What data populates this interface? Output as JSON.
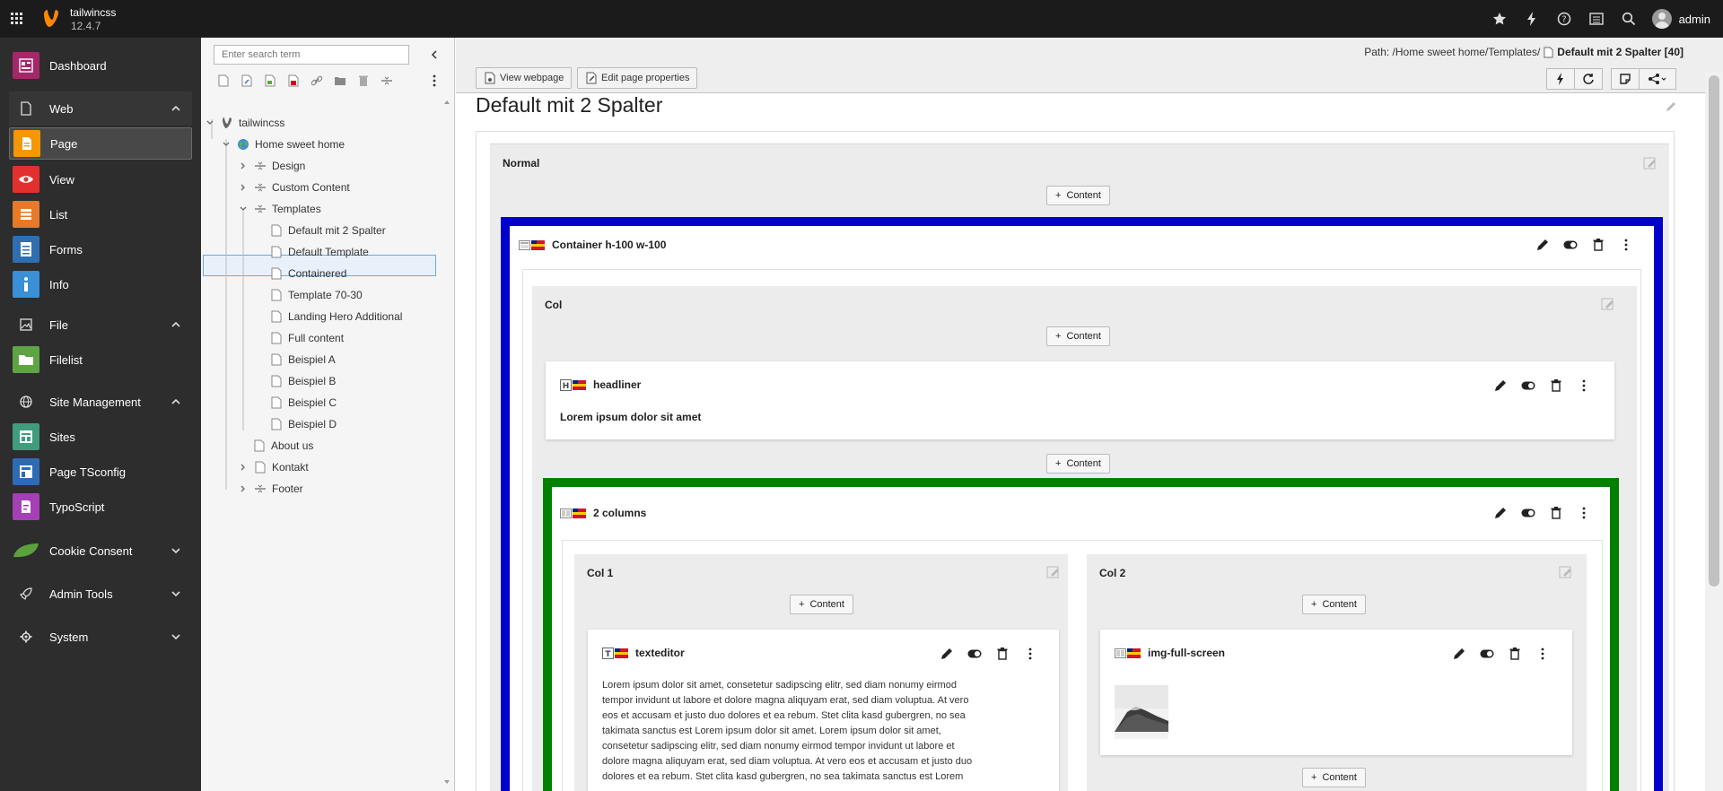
{
  "topbar": {
    "site_name": "tailwincss",
    "version": "12.4.7",
    "user": "admin"
  },
  "modules": {
    "dashboard": "Dashboard",
    "web": "Web",
    "page": "Page",
    "view": "View",
    "list": "List",
    "forms": "Forms",
    "info": "Info",
    "file": "File",
    "filelist": "Filelist",
    "site_management": "Site Management",
    "sites": "Sites",
    "page_tsconfig": "Page TSconfig",
    "typoscript": "TypoScript",
    "cookie_consent": "Cookie Consent",
    "admin_tools": "Admin Tools",
    "system": "System"
  },
  "tree": {
    "search_placeholder": "Enter search term",
    "nodes": [
      "tailwincss",
      "Home sweet home",
      "Design",
      "Custom Content",
      "Templates",
      "Default mit 2 Spalter",
      "Default Template",
      "Containered",
      "Template 70-30",
      "Landing Hero Additional",
      "Full content",
      "Beispiel A",
      "Beispiel B",
      "Beispiel C",
      "Beispiel D",
      "About us",
      "Kontakt",
      "Footer"
    ]
  },
  "docheader": {
    "path_label": "Path: /Home sweet home/Templates/",
    "path_page": "Default mit 2 Spalter [40]",
    "view_webpage": "View webpage",
    "edit_page_properties": "Edit page properties"
  },
  "page": {
    "title": "Default mit 2 Spalter",
    "column_normal": "Normal",
    "add_content": "Content"
  },
  "elements": {
    "container": {
      "title": "Container h-100 w-100",
      "col": "Col"
    },
    "headliner": {
      "title": "headliner",
      "text": "Lorem ipsum dolor sit amet"
    },
    "two_columns": {
      "title": "2 columns",
      "col1": "Col 1",
      "col2": "Col 2"
    },
    "texteditor": {
      "title": "texteditor",
      "lines": [
        "Lorem ipsum dolor sit amet, consetetur sadipscing elitr, sed diam nonumy eirmod",
        "tempor invidunt ut labore et dolore magna aliquyam erat, sed diam voluptua. At vero",
        "eos et accusam et justo duo dolores et ea rebum. Stet clita kasd gubergren, no sea",
        "takimata sanctus est Lorem ipsum dolor sit amet. Lorem ipsum dolor sit amet,",
        "consetetur sadipscing elitr, sed diam nonumy eirmod tempor invidunt ut labore et",
        "dolore magna aliquyam erat, sed diam voluptua. At vero eos et accusam et justo duo",
        "dolores et ea rebum. Stet clita kasd gubergren, no sea takimata sanctus est Lorem"
      ]
    },
    "img_full_screen": {
      "title": "img-full-screen"
    }
  },
  "colors": {
    "topbar": "#1b1b1b",
    "module_menu": "#2d2d2d",
    "container_border": "#0000cc",
    "columns_border": "#008000",
    "typo3_orange": "#ff8700"
  }
}
